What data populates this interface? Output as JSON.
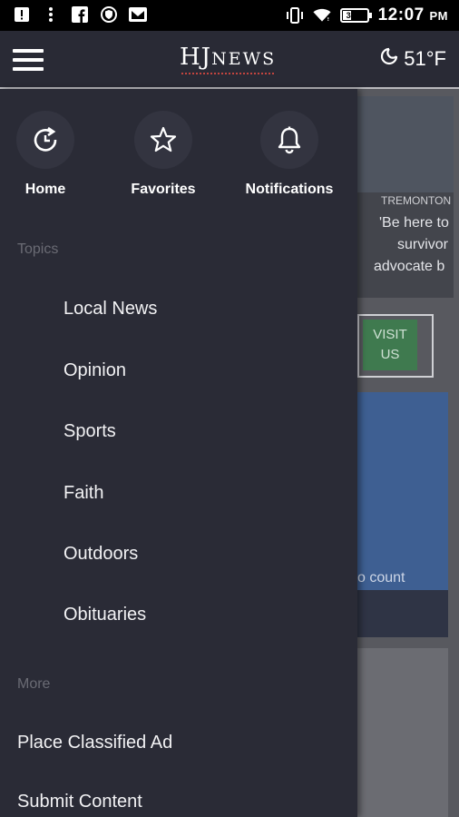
{
  "status_bar": {
    "time": "12:07",
    "ampm": "PM",
    "battery": "34%",
    "battery_level": 0.34
  },
  "app_bar": {
    "brand_main": "HJ",
    "brand_sub": "NEWS",
    "temperature": "51°F"
  },
  "drawer": {
    "quick_actions": [
      {
        "label": "Home",
        "icon": "home-refresh-icon"
      },
      {
        "label": "Favorites",
        "icon": "star-icon"
      },
      {
        "label": "Notifications",
        "icon": "bell-icon"
      }
    ],
    "topics_header": "Topics",
    "topics": [
      "Local News",
      "Opinion",
      "Sports",
      "Faith",
      "Outdoors",
      "Obituaries"
    ],
    "more_header": "More",
    "more_items": [
      "Place Classified Ad",
      "Submit Content"
    ]
  },
  "background": {
    "article_location": "TREMONTON",
    "article_headline_lines": [
      "'Be here to",
      "survivor",
      "advocate b"
    ],
    "visit_button": [
      "VISIT",
      "US"
    ],
    "card_caption": "o count"
  }
}
